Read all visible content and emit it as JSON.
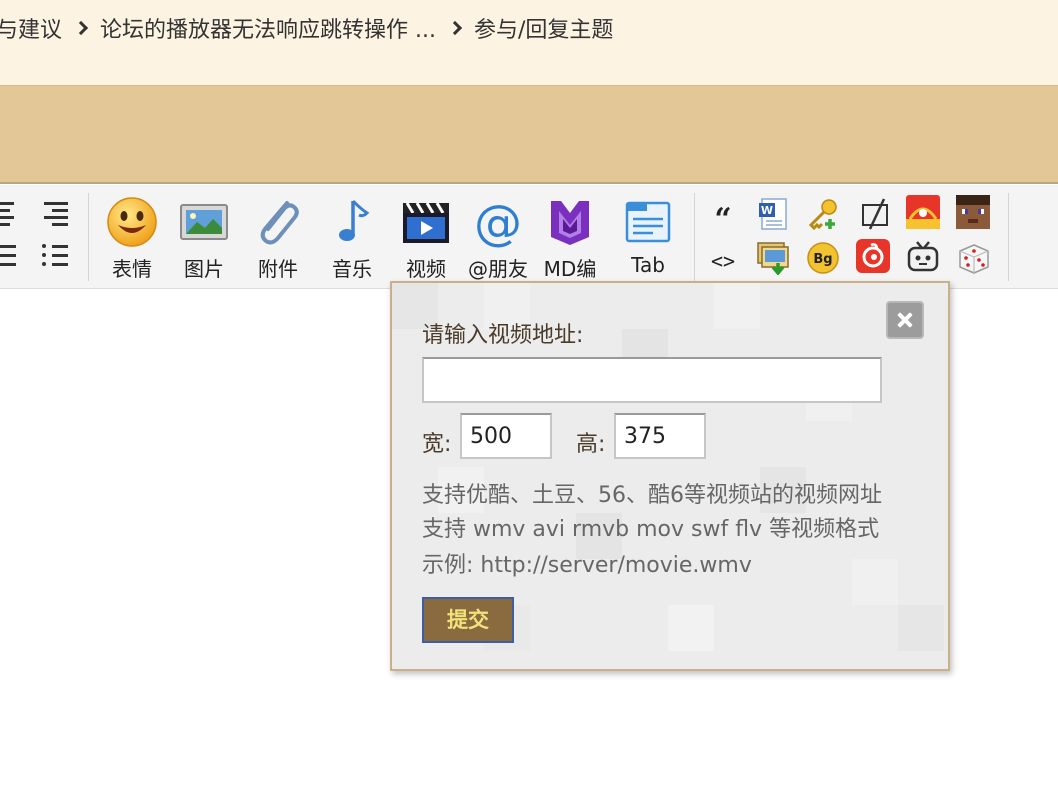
{
  "breadcrumb": {
    "items": [
      "与建议",
      "论坛的播放器无法响应跳转操作 ...",
      "参与/回复主题"
    ]
  },
  "toolbar": {
    "buttons": [
      {
        "label": "表情",
        "icon": "smiley-icon"
      },
      {
        "label": "图片",
        "icon": "image-icon"
      },
      {
        "label": "附件",
        "icon": "paperclip-icon"
      },
      {
        "label": "音乐",
        "icon": "music-note-icon"
      },
      {
        "label": "视频",
        "icon": "film-icon"
      },
      {
        "label": "@朋友",
        "icon": "at-icon"
      },
      {
        "label": "MD编",
        "icon": "markdown-icon"
      },
      {
        "label": "Tab",
        "icon": "tab-icon"
      }
    ],
    "small_icons": {
      "row1": [
        "quote-icon",
        "word-doc-icon",
        "key-add-icon",
        "free-format-icon",
        "sina-weibo-icon",
        "minecraft-head-icon"
      ],
      "row2": [
        "code-icon",
        "image-download-icon",
        "bg-badge-icon",
        "netease-music-icon",
        "tv-robot-icon",
        "dice-icon"
      ],
      "quote_glyph": "“",
      "code_glyph": "<>",
      "bg_text": "Bg",
      "word_text": "W"
    }
  },
  "dialog": {
    "title": "请输入视频地址:",
    "url_value": "",
    "width_label": "宽:",
    "width_value": "500",
    "height_label": "高:",
    "height_value": "375",
    "info": [
      "支持优酷、土豆、56、酷6等视频站的视频网址",
      "支持 wmv avi rmvb mov swf flv 等视频格式",
      "示例: http://server/movie.wmv"
    ],
    "submit_label": "提交"
  },
  "colors": {
    "breadcrumb_bg": "#fdf3e3",
    "tan_bar": "#e3c796",
    "submit_bg": "#8a6b3f",
    "submit_text": "#f2e27a"
  }
}
